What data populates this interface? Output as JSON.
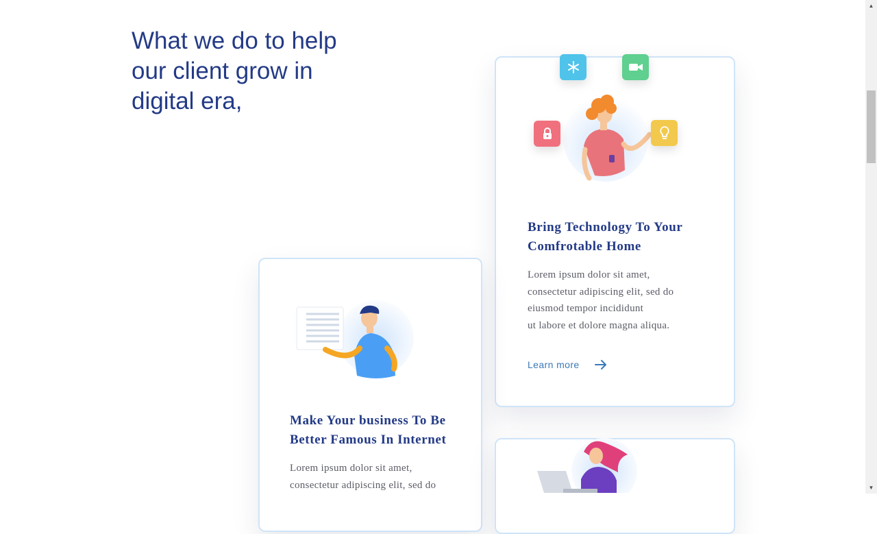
{
  "heading": {
    "lines": [
      "What we do to help",
      "our client grow in",
      "digital era,"
    ]
  },
  "cards": [
    {
      "title_lines": [
        "Bring Technology To Your",
        "Comfrotable Home"
      ],
      "body_lines": [
        "Lorem ipsum dolor sit amet,",
        "consectetur adipiscing elit, sed do",
        "eiusmod tempor incididunt",
        "ut labore et dolore magna aliqua."
      ],
      "link_label": "Learn more",
      "badges": [
        "snowflake-icon",
        "video-camera-icon",
        "lock-icon",
        "lightbulb-icon"
      ]
    },
    {
      "title_lines": [
        "Make Your business To Be",
        "Better Famous In Internet"
      ],
      "body_lines": [
        "Lorem ipsum dolor sit amet,",
        "consectetur adipiscing elit, sed do"
      ]
    }
  ],
  "colors": {
    "heading": "#233a86",
    "link": "#3a78b8",
    "card_border": "#cfe4f8",
    "badge_blue": "#4fc3ea",
    "badge_green": "#5fd08f",
    "badge_red": "#f0707e",
    "badge_yellow": "#f2c94c"
  }
}
